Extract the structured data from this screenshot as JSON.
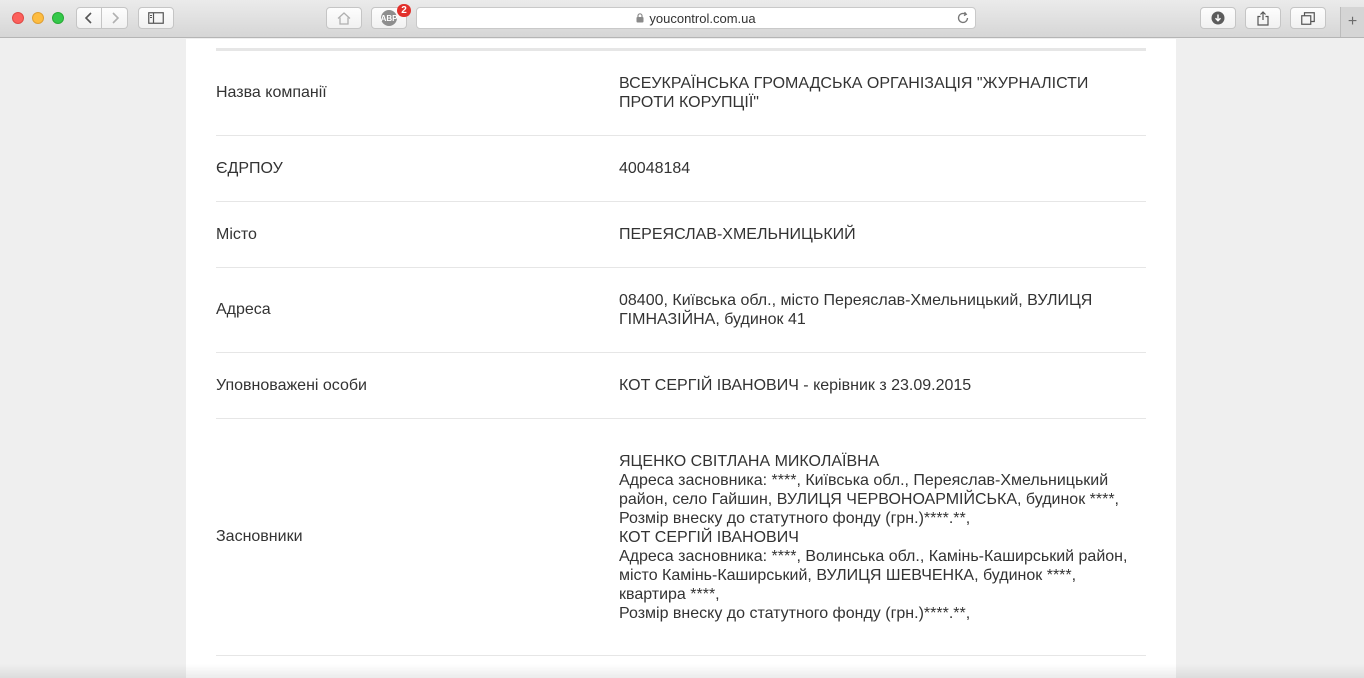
{
  "browser": {
    "url": "youcontrol.com.ua",
    "adblock_badge": "ABP",
    "adblock_count": "2",
    "new_tab_label": "+"
  },
  "icons": {
    "back": "chevron-left-icon",
    "forward": "chevron-right-icon",
    "sidebar": "sidebar-icon",
    "home": "home-icon",
    "lock": "lock-icon",
    "reload": "reload-icon",
    "download": "download-icon",
    "share": "share-icon",
    "tabs": "tabs-icon"
  },
  "company": {
    "rows": {
      "name": {
        "label": "Назва компанії",
        "value": "ВСЕУКРАЇНСЬКА ГРОМАДСЬКА ОРГАНІЗАЦІЯ \"ЖУРНАЛІСТИ ПРОТИ КОРУПЦІЇ\""
      },
      "edrpou": {
        "label": "ЄДРПОУ",
        "value": "40048184"
      },
      "city": {
        "label": "Місто",
        "value": "ПЕРЕЯСЛАВ-ХМЕЛЬНИЦЬКИЙ"
      },
      "address": {
        "label": "Адреса",
        "value": "08400, Київська обл., місто Переяслав-Хмельницький, ВУЛИЦЯ ГІМНАЗІЙНА, будинок 41"
      },
      "authorized": {
        "label": "Уповноважені особи",
        "value": "КОТ СЕРГІЙ ІВАНОВИЧ - керівник з 23.09.2015"
      },
      "founders": {
        "label": "Засновники",
        "items": [
          {
            "name": "ЯЦЕНКО СВІТЛАНА МИКОЛАЇВНА",
            "address": "Адреса засновника: ****, Київська обл., Переяслав-Хмельницький район, село Гайшин, ВУЛИЦЯ ЧЕРВОНОАРМІЙСЬКА, будинок ****,",
            "fund": "Розмір внеску до статутного фонду (грн.)****.**,"
          },
          {
            "name": "КОТ СЕРГІЙ ІВАНОВИЧ",
            "address": "Адреса засновника: ****, Волинська обл., Камінь-Каширський район, місто Камінь-Каширський, ВУЛИЦЯ ШЕВЧЕНКА, будинок ****, квартира ****,",
            "fund": "Розмір внеску до статутного фонду (грн.)****.**,"
          }
        ]
      }
    }
  }
}
